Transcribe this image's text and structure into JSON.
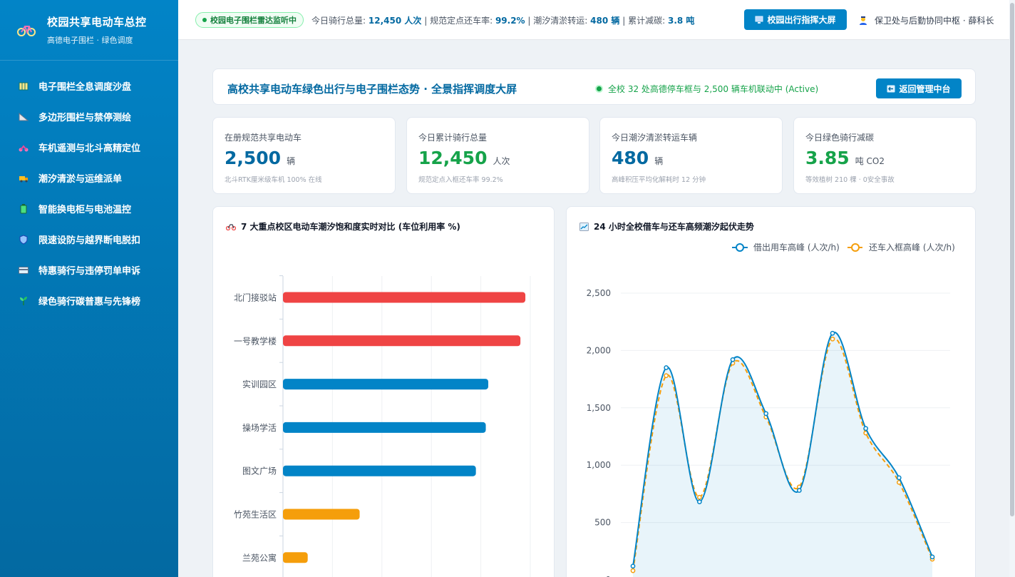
{
  "sidebar": {
    "brand_title": "校园共享电动车总控",
    "brand_subtitle": "高德电子围栏 · 绿色调度",
    "items": [
      {
        "label": "电子围栏全息调度沙盘",
        "icon": "map-icon"
      },
      {
        "label": "多边形围栏与禁停测绘",
        "icon": "ruler-triangle-icon"
      },
      {
        "label": "车机遥测与北斗高精定位",
        "icon": "scooter-icon"
      },
      {
        "label": "潮汐清淤与运维派单",
        "icon": "truck-icon"
      },
      {
        "label": "智能换电柜与电池温控",
        "icon": "battery-icon"
      },
      {
        "label": "限速设防与越界断电脱扣",
        "icon": "shield-icon"
      },
      {
        "label": "特惠骑行与违停罚单申诉",
        "icon": "card-icon"
      },
      {
        "label": "绿色骑行碳普惠与先锋榜",
        "icon": "sprout-icon"
      }
    ]
  },
  "topbar": {
    "radar_badge": "校园电子围栏雷达监听中",
    "ticker": {
      "rides_label": "今日骑行总量:",
      "rides_value": "12,450 人次",
      "sep1": "|",
      "return_label": "规范定点还车率:",
      "return_value": "99.2%",
      "sep2": "|",
      "tidal_label": "潮汐清淤转运:",
      "tidal_value": "480 辆",
      "sep3": "|",
      "carbon_label": "累计减碳:",
      "carbon_value": "3.8 吨"
    },
    "screen_button": "校园出行指挥大屏",
    "user": "保卫处与后勤协同中枢 · 薛科长"
  },
  "hero": {
    "title": "高校共享电动车绿色出行与电子围栏态势 · 全景指挥调度大屏",
    "status": "全校 32 处高德停车框与 2,500 辆车机联动中 (Active)",
    "back_button": "返回管理中台"
  },
  "kpis": [
    {
      "label": "在册规范共享电动车",
      "value": "2,500",
      "unit": "辆",
      "note": "北斗RTK厘米级车机 100% 在线",
      "color": "#0369a1"
    },
    {
      "label": "今日累计骑行总量",
      "value": "12,450",
      "unit": "人次",
      "note": "规范定点入框还车率 99.2%",
      "color": "#16a34a"
    },
    {
      "label": "今日潮汐清淤转运车辆",
      "value": "480",
      "unit": "辆",
      "note": "高峰积压平均化解耗时 12 分钟",
      "color": "#0369a1"
    },
    {
      "label": "今日绿色骑行减碳",
      "value": "3.85",
      "unit": "吨 CO2",
      "note": "等效植树 210 棵 · 0安全事故",
      "color": "#16a34a"
    }
  ],
  "chart_data": [
    {
      "type": "bar",
      "title": "7 大重点校区电动车潮汐饱和度实时对比 (车位利用率 %)",
      "orientation": "horizontal",
      "categories": [
        "北门接驳站",
        "一号教学楼",
        "实训园区",
        "操场学活",
        "图文广场",
        "竹苑生活区",
        "兰苑公寓"
      ],
      "values": [
        98,
        96,
        83,
        82,
        78,
        31,
        10
      ],
      "bar_colors": [
        "#ef4444",
        "#ef4444",
        "#0284c7",
        "#0284c7",
        "#0284c7",
        "#f59e0b",
        "#f59e0b"
      ],
      "xlim": [
        0,
        100
      ],
      "grid": true
    },
    {
      "type": "line",
      "title": "24 小时全校借车与还车高频潮汐起伏走势",
      "x_count": 9,
      "ylim": [
        0,
        2500
      ],
      "yticks": [
        "2,500",
        "2,000",
        "1,500",
        "1,000",
        "500",
        "0"
      ],
      "legend_position": "top-right",
      "series": [
        {
          "name": "借出用车高峰 (人次/h)",
          "values": [
            120,
            1850,
            680,
            1920,
            1450,
            780,
            2150,
            1320,
            890,
            200
          ],
          "color": "#0284c7"
        },
        {
          "name": "还车入框高峰 (人次/h)",
          "values": [
            80,
            1780,
            720,
            1890,
            1420,
            810,
            2100,
            1280,
            850,
            180
          ],
          "color": "#f59e0b"
        }
      ]
    }
  ]
}
